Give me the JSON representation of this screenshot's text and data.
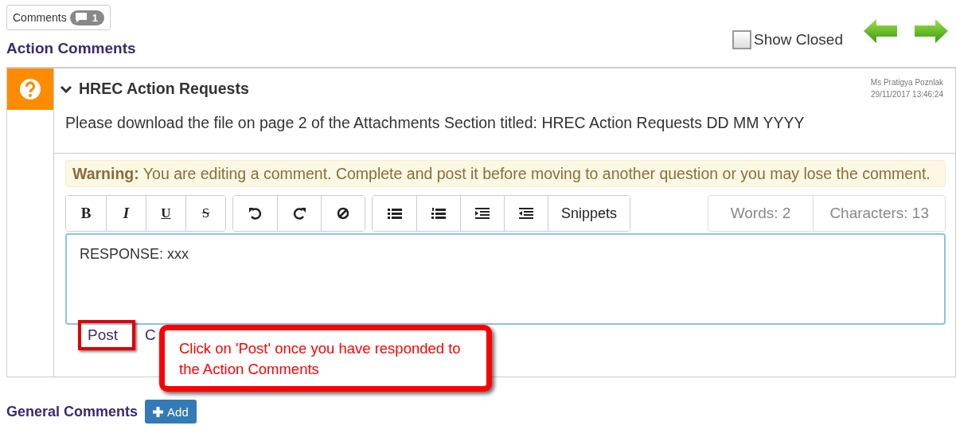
{
  "comments_button": {
    "label": "Comments",
    "count": "1"
  },
  "action_heading": "Action Comments",
  "show_closed": {
    "label": "Show Closed",
    "checked": false
  },
  "comment": {
    "title": "HREC Action Requests",
    "expanded": true,
    "author": "Ms Pratigya Poznlak",
    "timestamp": "29/11/2017 13:46:24",
    "body": "Please download the file on page 2 of the Attachments Section titled: HREC Action Requests DD MM YYYY"
  },
  "warning": "**Warning:** You are editing a comment. Complete and post it before moving to another question or you may lose the comment.",
  "toolbar": [
    [
      {
        "kind": "bold",
        "label": "B"
      },
      {
        "kind": "italic",
        "label": "I"
      },
      {
        "kind": "underline",
        "label": "U"
      },
      {
        "kind": "strike",
        "label": "S"
      }
    ],
    [
      {
        "kind": "undo"
      },
      {
        "kind": "redo"
      },
      {
        "kind": "clear"
      }
    ],
    [
      {
        "kind": "bullets"
      },
      {
        "kind": "numbers"
      },
      {
        "kind": "indent"
      },
      {
        "kind": "outdent"
      },
      {
        "kind": "text",
        "label": "Snippets"
      }
    ]
  ],
  "counters": [
    "Words: 2",
    "Characters: 13"
  ],
  "editor_value": "RESPONSE: xxx",
  "actions": [
    {
      "label": "Post",
      "highlighted": true
    },
    {
      "label": "C",
      "highlighted": false
    }
  ],
  "callout": "Click on 'Post' once you have responded to the Action Comments",
  "general_heading": "General Comments",
  "add_button": "Add"
}
